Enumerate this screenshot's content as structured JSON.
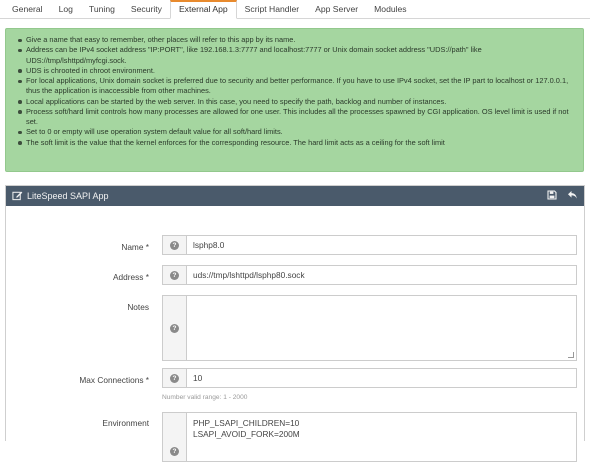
{
  "tabs": [
    {
      "label": "General",
      "active": false
    },
    {
      "label": "Log",
      "active": false
    },
    {
      "label": "Tuning",
      "active": false
    },
    {
      "label": "Security",
      "active": false
    },
    {
      "label": "External App",
      "active": true
    },
    {
      "label": "Script Handler",
      "active": false
    },
    {
      "label": "App Server",
      "active": false
    },
    {
      "label": "Modules",
      "active": false
    }
  ],
  "info": [
    "Give a name that easy to remember, other places will refer to this app by its name.",
    "Address can be IPv4 socket address \"IP:PORT\", like 192.168.1.3:7777 and localhost:7777 or Unix domain socket address \"UDS://path\" like UDS://tmp/lshttpd/myfcgi.sock.",
    "UDS is chrooted in chroot environment.",
    "For local applications, Unix domain socket is preferred due to security and better performance. If you have to use IPv4 socket, set the IP part to localhost or 127.0.0.1, thus the application is inaccessible from other machines.",
    "Local applications can be started by the web server. In this case, you need to specify the path, backlog and number of instances.",
    "Process soft/hard limit controls how many processes are allowed for one user. This includes all the processes spawned by CGI application. OS level limit is used if not set.",
    "Set to 0 or empty will use operation system default value for all soft/hard limits.",
    "The soft limit is the value that the kernel enforces for the corresponding resource. The hard limit acts as a ceiling for the soft limit"
  ],
  "panel": {
    "title": "LiteSpeed SAPI App",
    "edit_icon": "edit-icon",
    "save_icon": "save-icon",
    "back_icon": "back-icon"
  },
  "form": {
    "name": {
      "label": "Name *",
      "value": "lsphp8.0"
    },
    "address": {
      "label": "Address *",
      "value": "uds://tmp/lshttpd/lsphp80.sock"
    },
    "notes": {
      "label": "Notes",
      "value": ""
    },
    "max_connections": {
      "label": "Max Connections *",
      "value": "10",
      "note": "Number valid range: 1 - 2000"
    },
    "environment": {
      "label": "Environment",
      "lines": [
        "PHP_LSAPI_CHILDREN=10",
        "LSAPI_AVOID_FORK=200M"
      ]
    }
  },
  "colors": {
    "active_tab_accent": "#e88a2e",
    "info_bg": "#a5d6a0",
    "panel_header_bg": "#4a5a6b"
  }
}
